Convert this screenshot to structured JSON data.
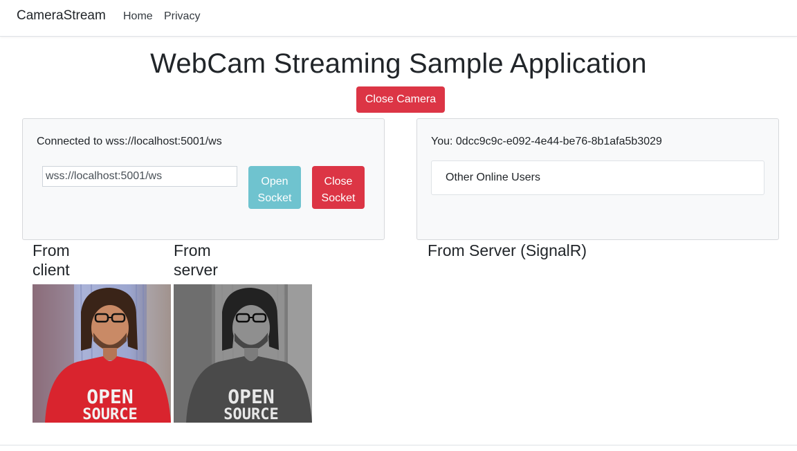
{
  "navbar": {
    "brand": "CameraStream",
    "links": [
      "Home",
      "Privacy"
    ]
  },
  "page": {
    "title": "WebCam Streaming Sample Application",
    "close_camera_label": "Close Camera"
  },
  "socket_panel": {
    "status_text": "Connected to wss://localhost:5001/ws",
    "url_value": "wss://localhost:5001/ws",
    "open_label_line1": "Open",
    "open_label_line2": "Socket",
    "close_label_line1": "Close",
    "close_label_line2": "Socket"
  },
  "users_panel": {
    "you_text": "You: 0dcc9c9c-e092-4e44-be76-8b1afa5b3029",
    "other_users_title": "Other Online Users"
  },
  "sections": {
    "from_client_line1": "From",
    "from_client_line2": "client",
    "from_server_line1": "From",
    "from_server_line2": "server",
    "from_signalr": "From Server (SignalR)"
  },
  "shirt_text": {
    "line1": "OPEN",
    "line2": "SOURCE"
  },
  "colors": {
    "danger": "#dc3545",
    "info": "#6fc3cf",
    "panel_bg": "#f8f9fa"
  }
}
